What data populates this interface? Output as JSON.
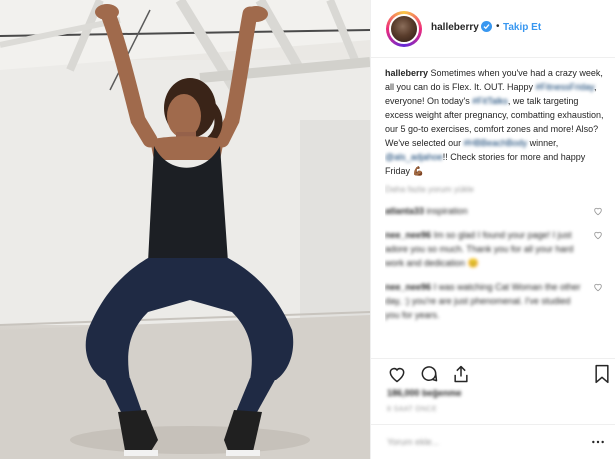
{
  "post": {
    "author": {
      "username": "halleberry",
      "verified": true,
      "separator": "•",
      "follow_label": "Takip Et"
    },
    "caption": {
      "username": "halleberry",
      "part1": "Sometimes when you've had a crazy week, all you can do is Flex. It. OUT. Happy",
      "tag1": "#FitnessFriday",
      "part2": ", everyone! On today's",
      "tag2": "#FitTalks",
      "part3": ", we talk targeting excess weight after pregnancy, combatting exhaustion, our 5 go-to exercises, comfort zones and more! Also? We've selected our",
      "tag3": "#HBBeachBody",
      "part4": "winner,",
      "tag4": "@als_adjahoe",
      "part5": "!! Check stories for more and happy Friday",
      "emoji": "💪🏾"
    },
    "load_more": "Daha fazla yorum yükle",
    "comments": [
      {
        "username": "atlanta33",
        "text": "inspiration"
      },
      {
        "username": "nee_nee96",
        "text": "Im so glad I found your page! I just adore you so much. Thank you for all your hard work and dedication",
        "emoji": "😊"
      },
      {
        "username": "nee_nee96",
        "text": "I was watching Cat Woman the other day, :) you're are just phenomenal. I've studied you for years."
      }
    ],
    "likes": "186,000 beğenme",
    "timestamp": "8 SAAT ÖNCE",
    "add_comment_placeholder": "Yorum ekle...",
    "colors": {
      "link_blue": "#3897f0",
      "hashtag": "#003569",
      "verified_badge": "#3897f0",
      "text": "#262626",
      "muted": "#999999"
    },
    "icons": [
      "heart-icon",
      "comment-icon",
      "share-icon",
      "bookmark-icon",
      "more-icon"
    ]
  }
}
